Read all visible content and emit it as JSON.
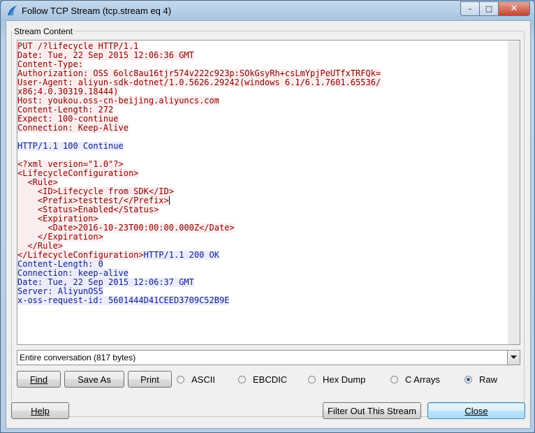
{
  "window": {
    "title": "Follow TCP Stream (tcp.stream eq 4)"
  },
  "group": {
    "label": "Stream Content"
  },
  "stream": {
    "lines": [
      {
        "dir": "c",
        "text": "PUT /?lifecycle HTTP/1.1"
      },
      {
        "dir": "c",
        "text": "Date: Tue, 22 Sep 2015 12:06:36 GMT"
      },
      {
        "dir": "c",
        "text": "Content-Type:"
      },
      {
        "dir": "c",
        "text": "Authorization: OSS 6olc8au16tjr574v222c923p:SOkGsyRh+csLmYpjPeUTfxTRFQk="
      },
      {
        "dir": "c",
        "text": "User-Agent: aliyun-sdk-dotnet/1.0.5626.29242(windows 6.1/6.1.7601.65536/"
      },
      {
        "dir": "c",
        "text": "x86;4.0.30319.18444)"
      },
      {
        "dir": "c",
        "text": "Host: youkou.oss-cn-beijing.aliyuncs.com"
      },
      {
        "dir": "c",
        "text": "Content-Length: 272"
      },
      {
        "dir": "c",
        "text": "Expect: 100-continue"
      },
      {
        "dir": "c",
        "text": "Connection: Keep-Alive"
      },
      {
        "dir": "blank",
        "text": ""
      },
      {
        "dir": "s",
        "text": "HTTP/1.1 100 Continue"
      },
      {
        "dir": "blank",
        "text": ""
      },
      {
        "dir": "c",
        "text": "<?xml version=\"1.0\"?>"
      },
      {
        "dir": "c",
        "text": "<LifecycleConfiguration>"
      },
      {
        "dir": "c",
        "text": "  <Rule>"
      },
      {
        "dir": "c",
        "text": "    <ID>Lifecycle from SDK</ID>"
      },
      {
        "dir": "c",
        "text": "    <Prefix>testtest/</Prefix>"
      },
      {
        "dir": "c",
        "text": "    <Status>Enabled</Status>"
      },
      {
        "dir": "c",
        "text": "    <Expiration>"
      },
      {
        "dir": "c",
        "text": "      <Date>2016-10-23T00:00:00.000Z</Date>"
      },
      {
        "dir": "c",
        "text": "    </Expiration>"
      },
      {
        "dir": "c",
        "text": "  </Rule>"
      },
      {
        "dir": "mix",
        "text": "</LifecycleConfiguration>",
        "text2": "HTTP/1.1 200 OK"
      },
      {
        "dir": "s",
        "text": "Content-Length: 0"
      },
      {
        "dir": "s",
        "text": "Connection: keep-alive"
      },
      {
        "dir": "s",
        "text": "Date: Tue, 22 Sep 2015 12:06:37 GMT"
      },
      {
        "dir": "s",
        "text": "Server: AliyunOSS"
      },
      {
        "dir": "s",
        "text": "x-oss-request-id: 5601444D41CEED3709C52B9E"
      }
    ]
  },
  "conversation": {
    "selected": "Entire conversation (817 bytes)"
  },
  "buttons": {
    "find": "Find",
    "save_as": "Save As",
    "print": "Print",
    "help": "Help",
    "filter": "Filter Out This Stream",
    "close": "Close"
  },
  "formats": [
    {
      "label": "ASCII",
      "selected": false
    },
    {
      "label": "EBCDIC",
      "selected": false
    },
    {
      "label": "Hex Dump",
      "selected": false
    },
    {
      "label": "C Arrays",
      "selected": false
    },
    {
      "label": "Raw",
      "selected": true
    }
  ],
  "colors": {
    "client_fg": "#8b0000",
    "client_bg": "#fbeded",
    "server_fg": "#0c1e8c",
    "server_bg": "#ececfb"
  }
}
